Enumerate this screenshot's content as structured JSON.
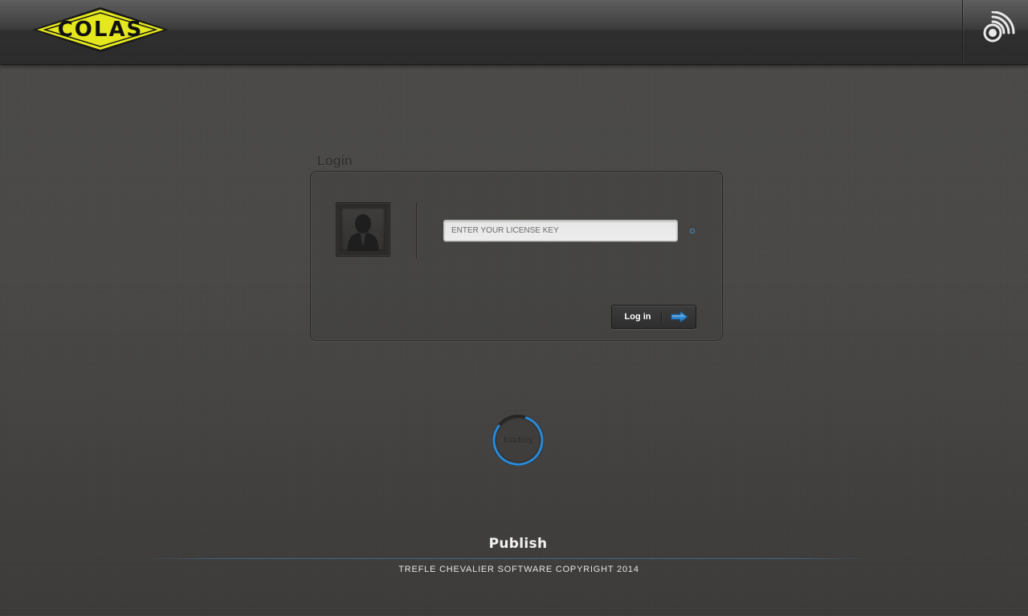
{
  "header": {
    "logo_text": "COLAS",
    "logo_color": "#e5e81c",
    "sync_icon": "sync-signal-icon"
  },
  "login": {
    "title": "Login",
    "avatar_icon": "user-avatar-icon",
    "license_placeholder": "ENTER YOUR LICENSE KEY",
    "license_value": "",
    "button_label": "Log in",
    "button_icon": "arrow-right-icon",
    "accent_color": "#2f86d0"
  },
  "loading": {
    "label": "loading"
  },
  "footer": {
    "brand": "Publish",
    "copyright": "TREFLE CHEVALIER SOFTWARE COPYRIGHT 2014"
  }
}
